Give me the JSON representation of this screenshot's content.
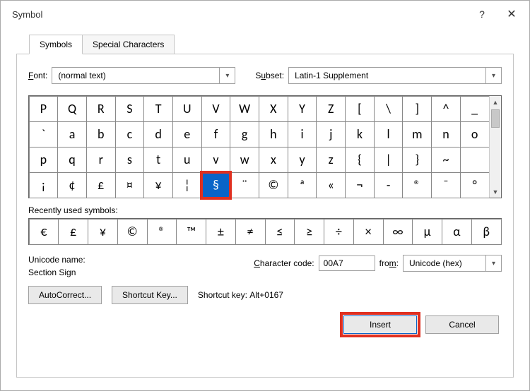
{
  "title": "Symbol",
  "tabs": {
    "symbols": "Symbols",
    "special": "Special Characters"
  },
  "labels": {
    "font": "Font:",
    "subset": "Subset:",
    "recent": "Recently used symbols:",
    "uname_label": "Unicode name:",
    "charcode": "Character code:",
    "from": "from:",
    "shortcut_key_static": "Shortcut key:"
  },
  "font_value": "(normal text)",
  "subset_value": "Latin-1 Supplement",
  "grid": [
    [
      "P",
      "Q",
      "R",
      "S",
      "T",
      "U",
      "V",
      "W",
      "X",
      "Y",
      "Z",
      "[",
      "\\",
      "]",
      "^",
      "_"
    ],
    [
      "`",
      "a",
      "b",
      "c",
      "d",
      "e",
      "f",
      "g",
      "h",
      "i",
      "j",
      "k",
      "l",
      "m",
      "n",
      "o"
    ],
    [
      "p",
      "q",
      "r",
      "s",
      "t",
      "u",
      "v",
      "w",
      "x",
      "y",
      "z",
      "{",
      "|",
      "}",
      "~",
      ""
    ],
    [
      "¡",
      "¢",
      "£",
      "¤",
      "¥",
      "¦",
      "§",
      "¨",
      "©",
      "ª",
      "«",
      "¬",
      "-",
      "®",
      "¯",
      "°"
    ]
  ],
  "selected": {
    "row": 3,
    "col": 6
  },
  "recent": [
    "€",
    "£",
    "¥",
    "©",
    "®",
    "™",
    "±",
    "≠",
    "≤",
    "≥",
    "÷",
    "×",
    "∞",
    "µ",
    "α",
    "β"
  ],
  "unicode_name": "Section Sign",
  "charcode_value": "00A7",
  "from_value": "Unicode (hex)",
  "shortcut_value": "Alt+0167",
  "buttons": {
    "autocorrect": "AutoCorrect...",
    "shortcut": "Shortcut Key...",
    "insert": "Insert",
    "cancel": "Cancel"
  },
  "help": "?"
}
